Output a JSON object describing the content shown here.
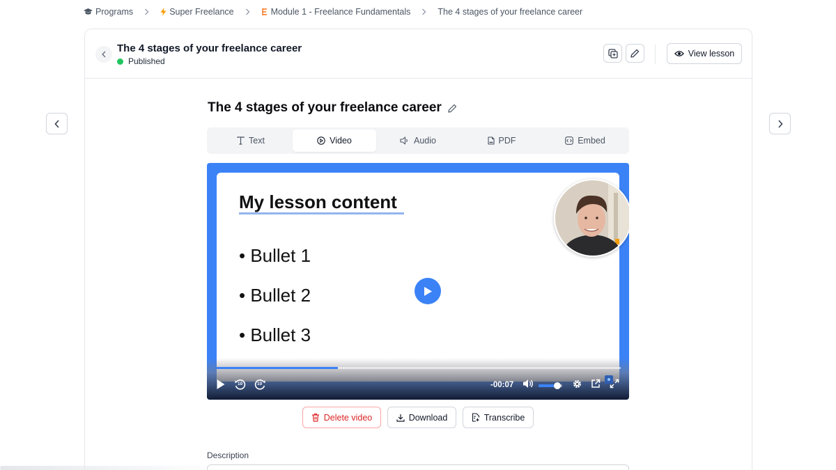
{
  "breadcrumb": {
    "items": [
      {
        "label": "Programs",
        "icon": "graduation-cap-icon"
      },
      {
        "label": "Super Freelance",
        "icon": "lightning-icon"
      },
      {
        "label": "Module 1 - Freelance Fundamentals",
        "icon": "module-icon"
      },
      {
        "label": "The 4 stages of your freelance career"
      }
    ]
  },
  "header": {
    "title": "The 4 stages of your freelance career",
    "status": "Published",
    "status_color": "#22c55e",
    "view_label": "View lesson"
  },
  "lesson": {
    "title": "The 4 stages of your freelance career"
  },
  "tabs": [
    {
      "label": "Text",
      "icon": "text-icon"
    },
    {
      "label": "Video",
      "icon": "play-circle-icon",
      "active": true
    },
    {
      "label": "Audio",
      "icon": "speaker-icon"
    },
    {
      "label": "PDF",
      "icon": "pdf-icon"
    },
    {
      "label": "Embed",
      "icon": "embed-icon"
    }
  ],
  "video": {
    "slide_title": "My lesson content",
    "bullets": [
      "• Bullet 1",
      "• Bullet 2",
      "• Bullet 3"
    ],
    "time_remaining": "-00:07",
    "progress": 0.3,
    "volume": 0.8,
    "rewind_label": "10",
    "forward_label": "10",
    "accent_color": "#3b82f6"
  },
  "actions": {
    "delete": "Delete video",
    "download": "Download",
    "transcribe": "Transcribe"
  },
  "description": {
    "label": "Description"
  }
}
